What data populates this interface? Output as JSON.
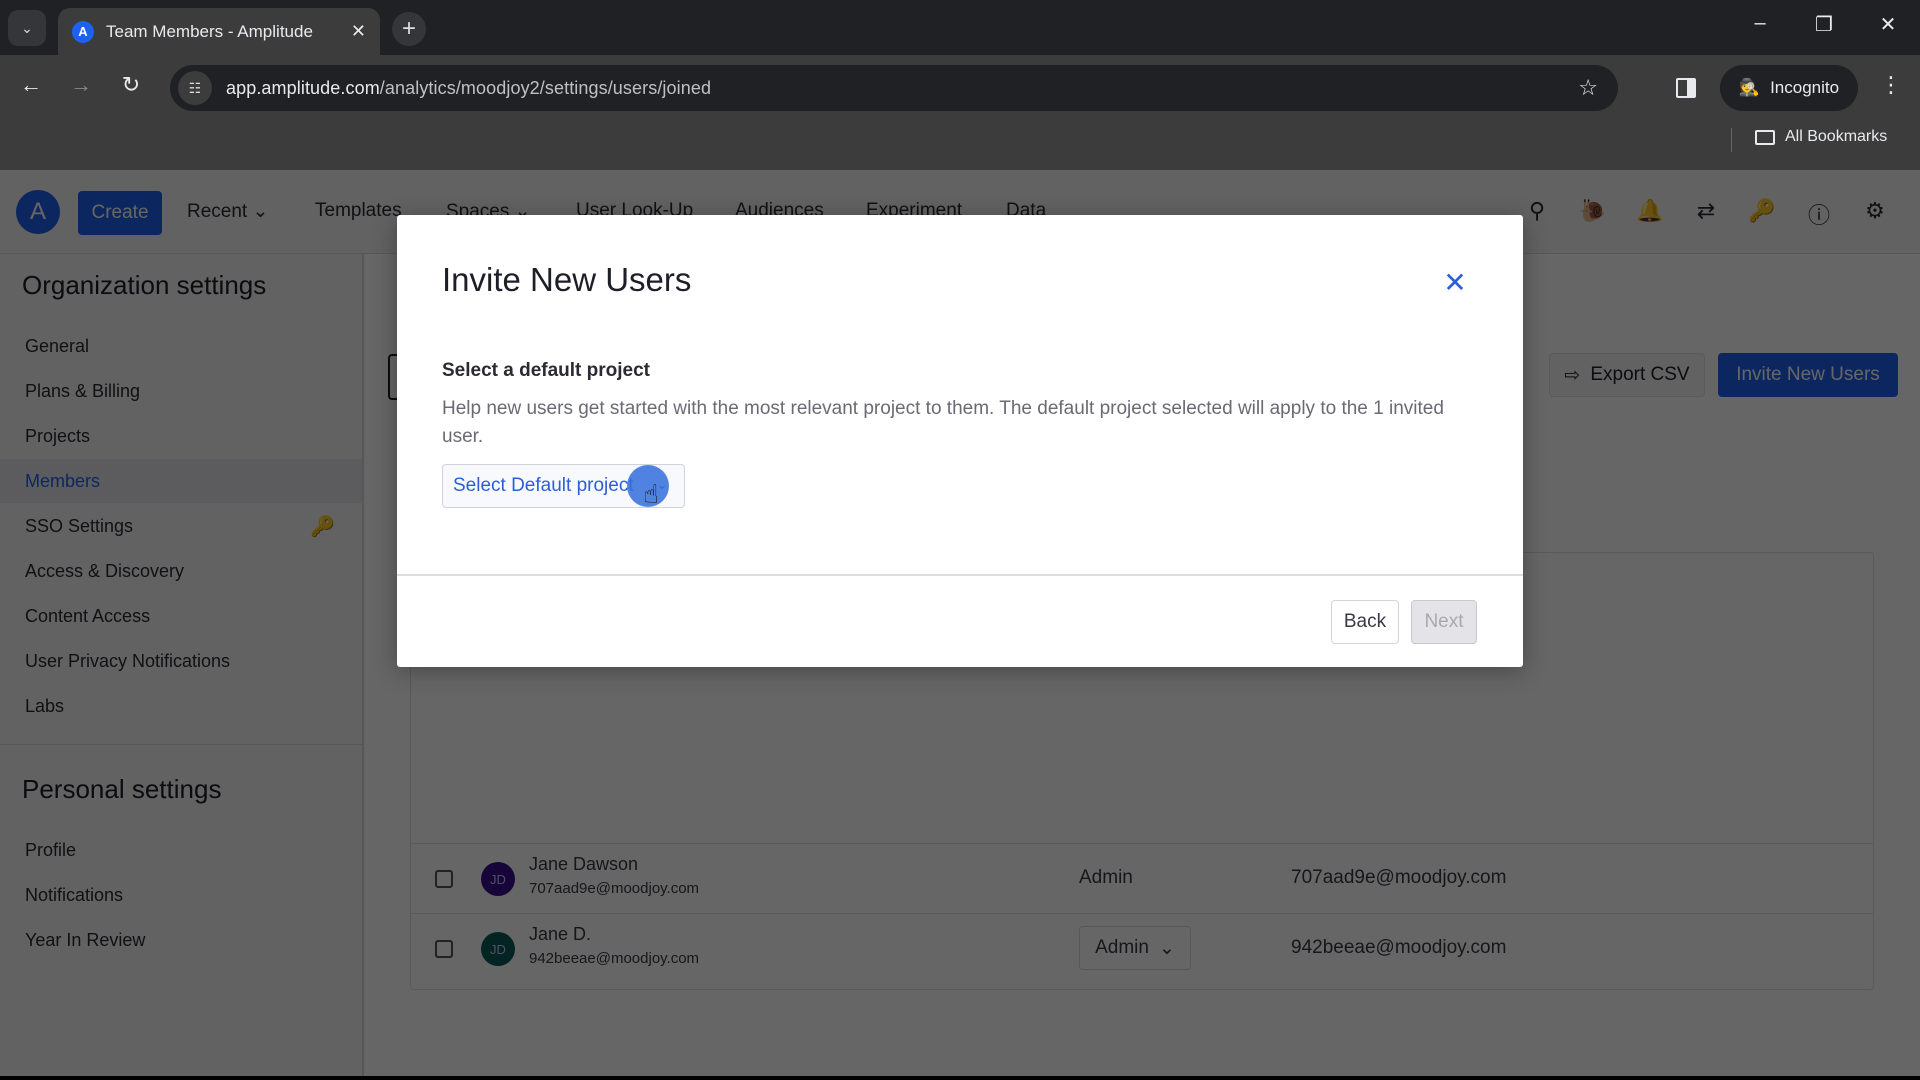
{
  "browser": {
    "tab_title": "Team Members - Amplitude",
    "url_host": "app.amplitude.com",
    "url_path": "/analytics/moodjoy2/settings/users/joined",
    "incognito_label": "Incognito",
    "bookmarks_label": "All Bookmarks",
    "icons": {
      "tab_list": "chevron-down-icon",
      "favicon": "amplitude-logo",
      "tab_close": "close-icon",
      "new_tab": "plus-icon",
      "back": "arrow-left-icon",
      "forward": "arrow-right-icon",
      "reload": "reload-icon",
      "site_info": "tune-icon",
      "bookmark_star": "star-icon",
      "side_panel": "side-panel-icon",
      "incognito": "incognito-icon",
      "menu": "kebab-menu-icon",
      "folder": "folder-icon",
      "minimize": "minimize-icon",
      "restore": "restore-icon",
      "close_window": "close-icon"
    }
  },
  "topnav": {
    "create_label": "Create",
    "items": [
      {
        "label": "Recent",
        "has_dropdown": true
      },
      {
        "label": "Templates",
        "has_dropdown": false
      },
      {
        "label": "Spaces",
        "has_dropdown": true
      },
      {
        "label": "User Look-Up",
        "has_dropdown": false
      },
      {
        "label": "Audiences",
        "has_dropdown": false
      },
      {
        "label": "Experiment",
        "has_dropdown": false
      },
      {
        "label": "Data",
        "has_dropdown": false
      }
    ],
    "right_icons": [
      "search-icon",
      "snail-icon",
      "bell-icon",
      "swap-icon",
      "key-sparkle-icon",
      "help-icon",
      "gear-icon"
    ]
  },
  "sidebar": {
    "org_heading": "Organization settings",
    "org_items": [
      {
        "label": "General"
      },
      {
        "label": "Plans & Billing"
      },
      {
        "label": "Projects"
      },
      {
        "label": "Members",
        "active": true
      },
      {
        "label": "SSO Settings",
        "icon": "key-sparkle-icon"
      },
      {
        "label": "Access & Discovery"
      },
      {
        "label": "Content Access"
      },
      {
        "label": "User Privacy Notifications"
      },
      {
        "label": "Labs"
      }
    ],
    "personal_heading": "Personal settings",
    "personal_items": [
      {
        "label": "Profile"
      },
      {
        "label": "Notifications"
      },
      {
        "label": "Year In Review"
      }
    ]
  },
  "main": {
    "export_csv_label": "Export CSV",
    "invite_label": "Invite New Users",
    "members": [
      {
        "initials": "JD",
        "name": "Jane Dawson",
        "email": "707aad9e@moodjoy.com",
        "role": "Admin",
        "role_editable": false,
        "avatar_color": "#3b0a8c"
      },
      {
        "initials": "JD",
        "name": "Jane D.",
        "email": "942beeae@moodjoy.com",
        "role": "Admin",
        "role_editable": true,
        "avatar_color": "#0a5a5a"
      }
    ]
  },
  "modal": {
    "title": "Invite New Users",
    "section_label": "Select a default project",
    "description": "Help new users get started with the most relevant project to them. The default project selected will apply to the 1 invited user.",
    "select_placeholder": "Select Default project",
    "back_label": "Back",
    "next_label": "Next",
    "next_disabled": true
  },
  "colors": {
    "brand": "#1e61f0",
    "link": "#2d5ed8"
  }
}
